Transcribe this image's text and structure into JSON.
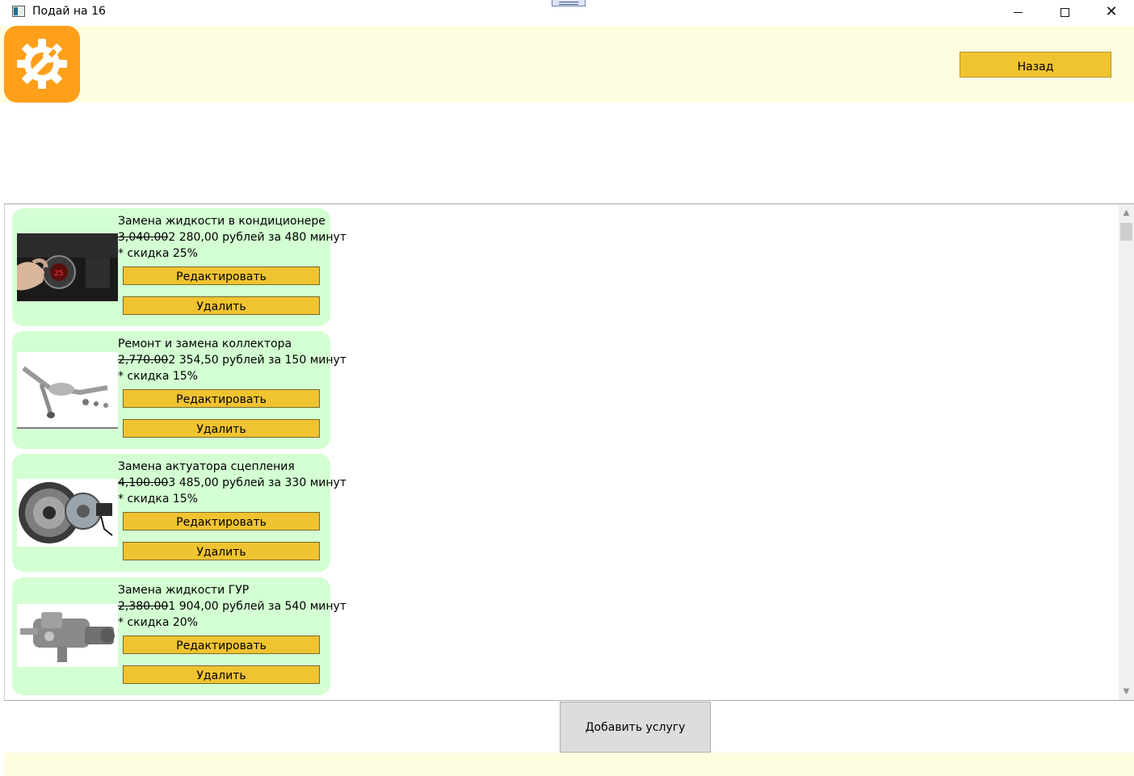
{
  "window": {
    "title": "Подай на 16",
    "close_symbol": "✕"
  },
  "header": {
    "logo_icon": "gear-wrench-icon",
    "logo_color": "#ff9f1a",
    "back_label": "Назад"
  },
  "services": [
    {
      "title": "Замена жидкости в кондиционере",
      "old_price": "3,040.00",
      "price_text": "2 280,00 рублей за 480 минут",
      "discount": "* скидка 25%",
      "image": "climate-control-photo"
    },
    {
      "title": "Ремонт и замена коллектора",
      "old_price": "2,770.00",
      "price_text": "2 354,50 рублей за 150 минут",
      "discount": "* скидка 15%",
      "image": "exhaust-manifold-photo"
    },
    {
      "title": "Замена актуатора сцепления",
      "old_price": "4,100.00",
      "price_text": "3 485,00 рублей за 330 минут",
      "discount": "* скидка 15%",
      "image": "clutch-kit-photo"
    },
    {
      "title": "Замена жидкости ГУР",
      "old_price": "2,380.00",
      "price_text": "1 904,00 рублей за 540 минут",
      "discount": "* скидка 20%",
      "image": "steering-gear-photo"
    }
  ],
  "card_buttons": {
    "edit_label": "Редактировать",
    "delete_label": "Удалить"
  },
  "footer": {
    "add_label": "Добавить услугу"
  },
  "colors": {
    "header_bg": "#fffde0",
    "card_bg": "#d3ffd2",
    "button_bg": "#f0c330"
  }
}
